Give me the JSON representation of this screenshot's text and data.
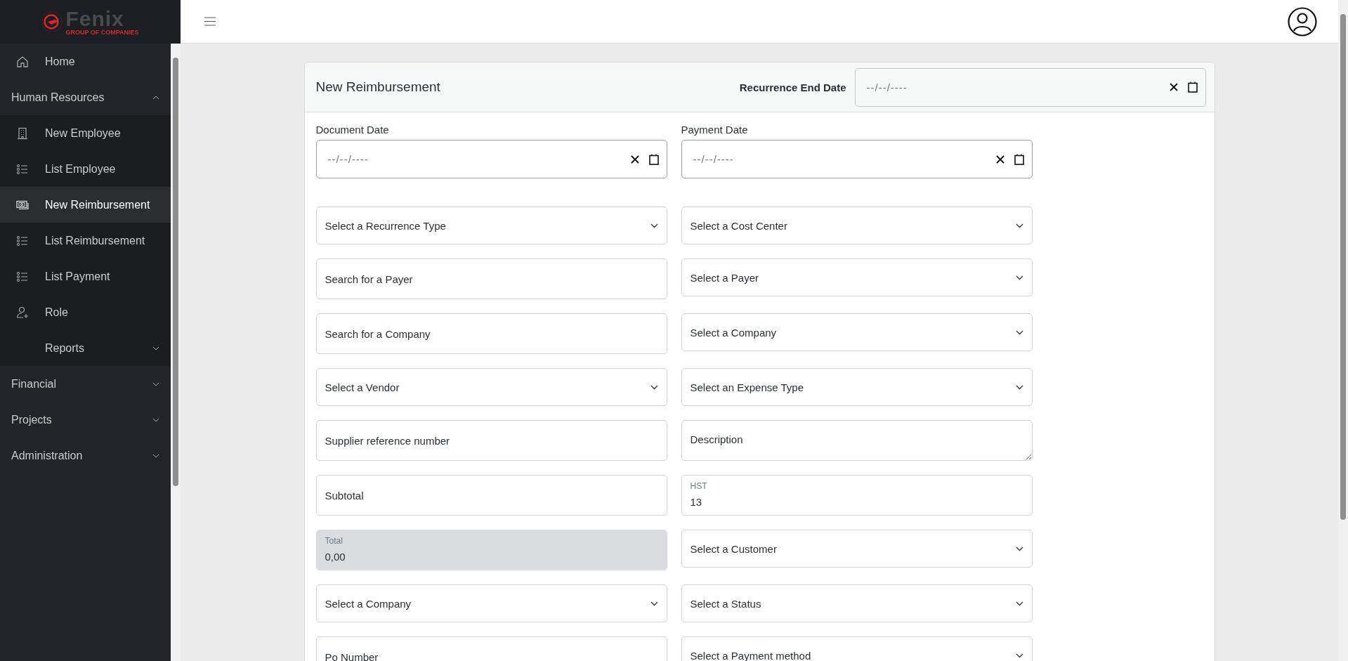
{
  "logo": {
    "name": "Fenix",
    "tagline": "GROUP OF COMPANIES"
  },
  "sidebar": {
    "items": [
      {
        "kind": "link",
        "label": "Home",
        "selected": false
      },
      {
        "kind": "group",
        "label": "Human Resources",
        "expanded": true,
        "children": [
          {
            "kind": "link",
            "label": "New Employee",
            "selected": false
          },
          {
            "kind": "link",
            "label": "List Employee",
            "selected": false
          },
          {
            "kind": "link",
            "label": "New Reimbursement",
            "selected": true
          },
          {
            "kind": "link",
            "label": "List Reimbursement",
            "selected": false
          },
          {
            "kind": "link",
            "label": "List Payment",
            "selected": false
          },
          {
            "kind": "link",
            "label": "Role",
            "selected": false
          },
          {
            "kind": "group",
            "label": "Reports",
            "expanded": false
          }
        ]
      },
      {
        "kind": "group",
        "label": "Financial",
        "expanded": false
      },
      {
        "kind": "group",
        "label": "Projects",
        "expanded": false
      },
      {
        "kind": "group",
        "label": "Administration",
        "expanded": false
      }
    ]
  },
  "form": {
    "title": "New Reimbursement",
    "recurrence_end_date": {
      "label": "Recurrence End Date",
      "placeholder": "--/--/----"
    },
    "fields": [
      {
        "kind": "date",
        "label": "Document Date",
        "placeholder": "--/--/----"
      },
      {
        "kind": "date",
        "label": "Payment Date",
        "placeholder": "--/--/----"
      },
      {
        "kind": "select",
        "placeholder": "Select a Recurrence Type"
      },
      {
        "kind": "select",
        "placeholder": "Select a Cost Center"
      },
      {
        "kind": "input",
        "placeholder": "Search for a Payer"
      },
      {
        "kind": "select",
        "placeholder": "Select a Payer"
      },
      {
        "kind": "input",
        "placeholder": "Search for a Company"
      },
      {
        "kind": "select",
        "placeholder": "Select a Company"
      },
      {
        "kind": "select",
        "placeholder": "Select a Vendor"
      },
      {
        "kind": "select",
        "placeholder": "Select an Expense Type"
      },
      {
        "kind": "input",
        "placeholder": "Supplier reference number"
      },
      {
        "kind": "textarea",
        "placeholder": "Description"
      },
      {
        "kind": "input",
        "placeholder": "Subtotal"
      },
      {
        "kind": "floating",
        "label": "HST",
        "value": "13",
        "disabled": false
      },
      {
        "kind": "floating",
        "label": "Total",
        "value": "0,00",
        "disabled": true
      },
      {
        "kind": "select",
        "placeholder": "Select a Customer"
      },
      {
        "kind": "select",
        "placeholder": "Select a Company"
      },
      {
        "kind": "select",
        "placeholder": "Select a Status"
      },
      {
        "kind": "input",
        "placeholder": "Po Number"
      },
      {
        "kind": "select",
        "placeholder": "Select a Payment method"
      }
    ]
  }
}
